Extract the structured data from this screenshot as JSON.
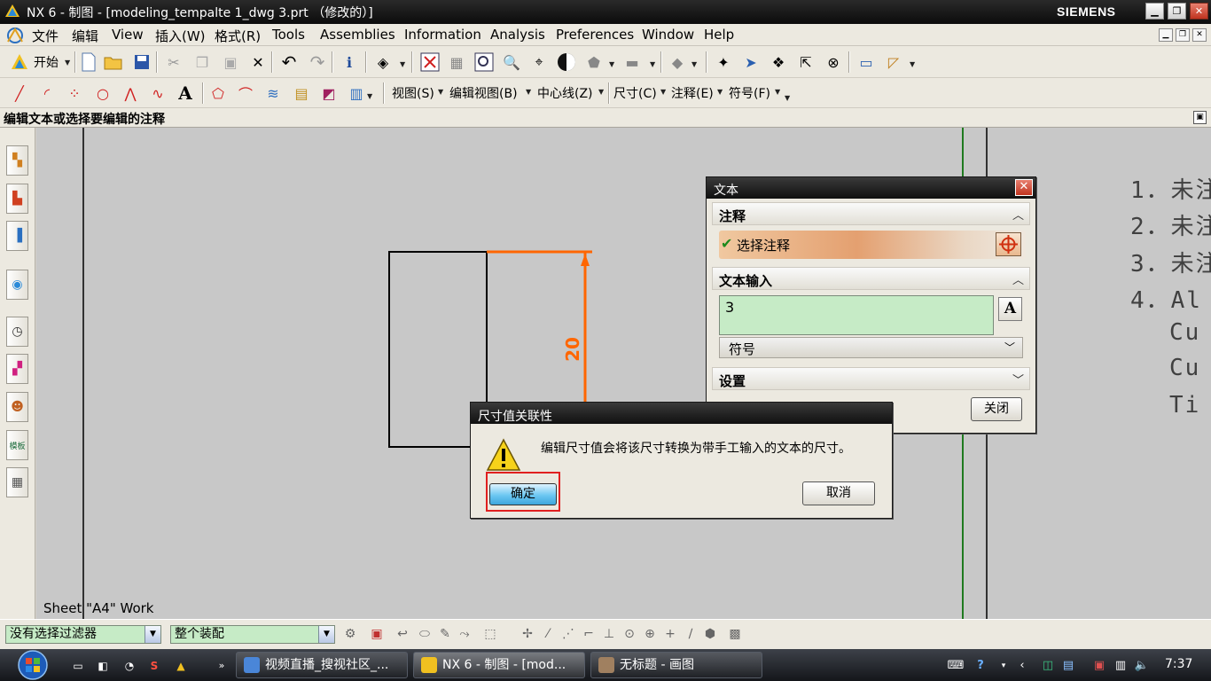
{
  "window": {
    "title": "NX 6 - 制图 - [modeling_tempalte 1_dwg 3.prt （修改的）]",
    "brand": "SIEMENS"
  },
  "menu": {
    "items": [
      "文件",
      "编辑",
      "View",
      "插入(W)",
      "格式(R)",
      "Tools",
      "Assemblies",
      "Information",
      "Analysis",
      "Preferences",
      "Window",
      "Help"
    ]
  },
  "toolbar": {
    "start_label": "开始",
    "drafting_menus": [
      "视图(S)",
      "编辑视图(B)",
      "中心线(Z)",
      "尺寸(C)",
      "注释(E)",
      "符号(F)"
    ]
  },
  "prompt": "编辑文本或选择要编辑的注释",
  "canvas": {
    "sheet_label": "Sheet \"A4\" Work",
    "dimension_value": "20",
    "notes": [
      "1．未注",
      "2．未注",
      "3．未注",
      "4．Al",
      "Cu",
      "Cu",
      "Ti"
    ]
  },
  "text_dialog": {
    "title": "文本",
    "group_annotation": "注释",
    "select_annotation": "选择注释",
    "group_text_input": "文本输入",
    "text_value": "3",
    "symbol_label": "符号",
    "group_settings": "设置",
    "close_label": "关闭"
  },
  "dim_dialog": {
    "title": "尺寸值关联性",
    "message": "编辑尺寸值会将该尺寸转换为带手工输入的文本的尺寸。",
    "ok_label": "确定",
    "cancel_label": "取消"
  },
  "selection_bar": {
    "filter_value": "没有选择过滤器",
    "scope_value": "整个装配"
  },
  "taskbar": {
    "tasks": [
      "视频直播_搜视社区_...",
      "NX 6 - 制图 - [mod...",
      "无标题 - 画图"
    ],
    "clock": "7:37"
  },
  "colors": {
    "dimension": "#ff6600",
    "border_line": "#1f7a1f",
    "text_input_bg": "#c6ebc6",
    "ok_button": "#6cc7f2",
    "highlight_outline": "#e02020"
  }
}
